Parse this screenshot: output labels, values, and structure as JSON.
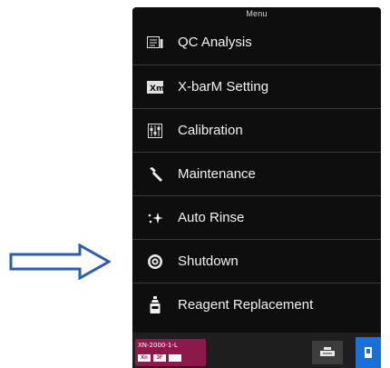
{
  "menu": {
    "title": "Menu",
    "items": [
      {
        "label": "QC Analysis",
        "icon": "qc-analysis-icon"
      },
      {
        "label": "X-barM Setting",
        "icon": "xbarm-icon"
      },
      {
        "label": "Calibration",
        "icon": "calibration-icon"
      },
      {
        "label": "Maintenance",
        "icon": "wrench-icon"
      },
      {
        "label": "Auto Rinse",
        "icon": "sparkle-icon"
      },
      {
        "label": "Shutdown",
        "icon": "power-icon"
      },
      {
        "label": "Reagent Replacement",
        "icon": "reagent-bottle-icon"
      }
    ]
  },
  "taskbar": {
    "analyzer_label": "XN-2000-1-L",
    "chip_1": "Xn",
    "chip_2": "3F",
    "accent_color": "#8b1a4a",
    "active_button_color": "#1a6fd8"
  },
  "annotation": {
    "arrow_color": "#2e5ea8",
    "arrow_target": "Shutdown"
  }
}
